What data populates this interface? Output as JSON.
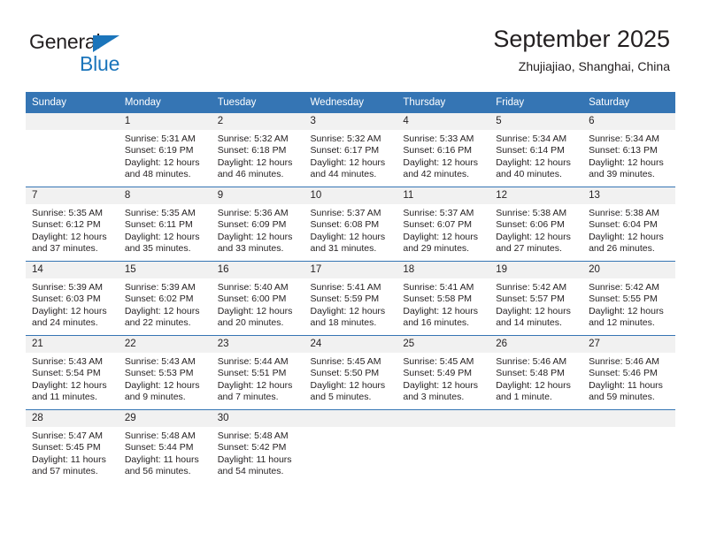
{
  "brand": {
    "name_part1": "General",
    "name_part2": "Blue",
    "triangle_color": "#1b75bb"
  },
  "header": {
    "title": "September 2025",
    "subtitle": "Zhujiajiao, Shanghai, China"
  },
  "theme": {
    "header_blue": "#3575b4",
    "daynum_band": "#f1f1f1",
    "text": "#231f20"
  },
  "calendar": {
    "weekday_headers": [
      "Sunday",
      "Monday",
      "Tuesday",
      "Wednesday",
      "Thursday",
      "Friday",
      "Saturday"
    ],
    "weeks": [
      [
        {
          "day": "",
          "blank": true,
          "sunrise": "",
          "sunset": "",
          "daylight1": "",
          "daylight2": ""
        },
        {
          "day": "1",
          "sunrise": "Sunrise: 5:31 AM",
          "sunset": "Sunset: 6:19 PM",
          "daylight1": "Daylight: 12 hours",
          "daylight2": "and 48 minutes."
        },
        {
          "day": "2",
          "sunrise": "Sunrise: 5:32 AM",
          "sunset": "Sunset: 6:18 PM",
          "daylight1": "Daylight: 12 hours",
          "daylight2": "and 46 minutes."
        },
        {
          "day": "3",
          "sunrise": "Sunrise: 5:32 AM",
          "sunset": "Sunset: 6:17 PM",
          "daylight1": "Daylight: 12 hours",
          "daylight2": "and 44 minutes."
        },
        {
          "day": "4",
          "sunrise": "Sunrise: 5:33 AM",
          "sunset": "Sunset: 6:16 PM",
          "daylight1": "Daylight: 12 hours",
          "daylight2": "and 42 minutes."
        },
        {
          "day": "5",
          "sunrise": "Sunrise: 5:34 AM",
          "sunset": "Sunset: 6:14 PM",
          "daylight1": "Daylight: 12 hours",
          "daylight2": "and 40 minutes."
        },
        {
          "day": "6",
          "sunrise": "Sunrise: 5:34 AM",
          "sunset": "Sunset: 6:13 PM",
          "daylight1": "Daylight: 12 hours",
          "daylight2": "and 39 minutes."
        }
      ],
      [
        {
          "day": "7",
          "sunrise": "Sunrise: 5:35 AM",
          "sunset": "Sunset: 6:12 PM",
          "daylight1": "Daylight: 12 hours",
          "daylight2": "and 37 minutes."
        },
        {
          "day": "8",
          "sunrise": "Sunrise: 5:35 AM",
          "sunset": "Sunset: 6:11 PM",
          "daylight1": "Daylight: 12 hours",
          "daylight2": "and 35 minutes."
        },
        {
          "day": "9",
          "sunrise": "Sunrise: 5:36 AM",
          "sunset": "Sunset: 6:09 PM",
          "daylight1": "Daylight: 12 hours",
          "daylight2": "and 33 minutes."
        },
        {
          "day": "10",
          "sunrise": "Sunrise: 5:37 AM",
          "sunset": "Sunset: 6:08 PM",
          "daylight1": "Daylight: 12 hours",
          "daylight2": "and 31 minutes."
        },
        {
          "day": "11",
          "sunrise": "Sunrise: 5:37 AM",
          "sunset": "Sunset: 6:07 PM",
          "daylight1": "Daylight: 12 hours",
          "daylight2": "and 29 minutes."
        },
        {
          "day": "12",
          "sunrise": "Sunrise: 5:38 AM",
          "sunset": "Sunset: 6:06 PM",
          "daylight1": "Daylight: 12 hours",
          "daylight2": "and 27 minutes."
        },
        {
          "day": "13",
          "sunrise": "Sunrise: 5:38 AM",
          "sunset": "Sunset: 6:04 PM",
          "daylight1": "Daylight: 12 hours",
          "daylight2": "and 26 minutes."
        }
      ],
      [
        {
          "day": "14",
          "sunrise": "Sunrise: 5:39 AM",
          "sunset": "Sunset: 6:03 PM",
          "daylight1": "Daylight: 12 hours",
          "daylight2": "and 24 minutes."
        },
        {
          "day": "15",
          "sunrise": "Sunrise: 5:39 AM",
          "sunset": "Sunset: 6:02 PM",
          "daylight1": "Daylight: 12 hours",
          "daylight2": "and 22 minutes."
        },
        {
          "day": "16",
          "sunrise": "Sunrise: 5:40 AM",
          "sunset": "Sunset: 6:00 PM",
          "daylight1": "Daylight: 12 hours",
          "daylight2": "and 20 minutes."
        },
        {
          "day": "17",
          "sunrise": "Sunrise: 5:41 AM",
          "sunset": "Sunset: 5:59 PM",
          "daylight1": "Daylight: 12 hours",
          "daylight2": "and 18 minutes."
        },
        {
          "day": "18",
          "sunrise": "Sunrise: 5:41 AM",
          "sunset": "Sunset: 5:58 PM",
          "daylight1": "Daylight: 12 hours",
          "daylight2": "and 16 minutes."
        },
        {
          "day": "19",
          "sunrise": "Sunrise: 5:42 AM",
          "sunset": "Sunset: 5:57 PM",
          "daylight1": "Daylight: 12 hours",
          "daylight2": "and 14 minutes."
        },
        {
          "day": "20",
          "sunrise": "Sunrise: 5:42 AM",
          "sunset": "Sunset: 5:55 PM",
          "daylight1": "Daylight: 12 hours",
          "daylight2": "and 12 minutes."
        }
      ],
      [
        {
          "day": "21",
          "sunrise": "Sunrise: 5:43 AM",
          "sunset": "Sunset: 5:54 PM",
          "daylight1": "Daylight: 12 hours",
          "daylight2": "and 11 minutes."
        },
        {
          "day": "22",
          "sunrise": "Sunrise: 5:43 AM",
          "sunset": "Sunset: 5:53 PM",
          "daylight1": "Daylight: 12 hours",
          "daylight2": "and 9 minutes."
        },
        {
          "day": "23",
          "sunrise": "Sunrise: 5:44 AM",
          "sunset": "Sunset: 5:51 PM",
          "daylight1": "Daylight: 12 hours",
          "daylight2": "and 7 minutes."
        },
        {
          "day": "24",
          "sunrise": "Sunrise: 5:45 AM",
          "sunset": "Sunset: 5:50 PM",
          "daylight1": "Daylight: 12 hours",
          "daylight2": "and 5 minutes."
        },
        {
          "day": "25",
          "sunrise": "Sunrise: 5:45 AM",
          "sunset": "Sunset: 5:49 PM",
          "daylight1": "Daylight: 12 hours",
          "daylight2": "and 3 minutes."
        },
        {
          "day": "26",
          "sunrise": "Sunrise: 5:46 AM",
          "sunset": "Sunset: 5:48 PM",
          "daylight1": "Daylight: 12 hours",
          "daylight2": "and 1 minute."
        },
        {
          "day": "27",
          "sunrise": "Sunrise: 5:46 AM",
          "sunset": "Sunset: 5:46 PM",
          "daylight1": "Daylight: 11 hours",
          "daylight2": "and 59 minutes."
        }
      ],
      [
        {
          "day": "28",
          "sunrise": "Sunrise: 5:47 AM",
          "sunset": "Sunset: 5:45 PM",
          "daylight1": "Daylight: 11 hours",
          "daylight2": "and 57 minutes."
        },
        {
          "day": "29",
          "sunrise": "Sunrise: 5:48 AM",
          "sunset": "Sunset: 5:44 PM",
          "daylight1": "Daylight: 11 hours",
          "daylight2": "and 56 minutes."
        },
        {
          "day": "30",
          "sunrise": "Sunrise: 5:48 AM",
          "sunset": "Sunset: 5:42 PM",
          "daylight1": "Daylight: 11 hours",
          "daylight2": "and 54 minutes."
        },
        {
          "day": "",
          "blank": true,
          "sunrise": "",
          "sunset": "",
          "daylight1": "",
          "daylight2": ""
        },
        {
          "day": "",
          "blank": true,
          "sunrise": "",
          "sunset": "",
          "daylight1": "",
          "daylight2": ""
        },
        {
          "day": "",
          "blank": true,
          "sunrise": "",
          "sunset": "",
          "daylight1": "",
          "daylight2": ""
        },
        {
          "day": "",
          "blank": true,
          "sunrise": "",
          "sunset": "",
          "daylight1": "",
          "daylight2": ""
        }
      ]
    ]
  }
}
